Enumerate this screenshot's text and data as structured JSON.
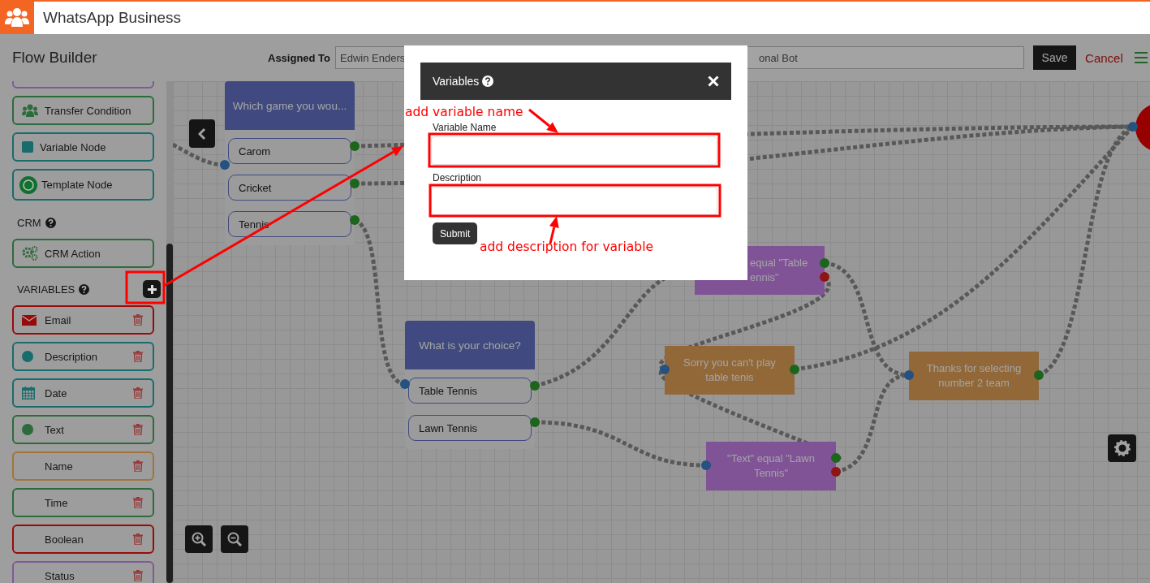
{
  "app": {
    "title": "WhatsApp Business"
  },
  "toolbar": {
    "title": "Flow Builder",
    "assigned_label": "Assigned To",
    "assigned_value": "Edwin Enders",
    "bot_name_value": "onal Bot",
    "save": "Save",
    "cancel": "Cancel"
  },
  "sidebar": {
    "nodes": [
      {
        "color": "#7d5a98",
        "kind": "plain"
      },
      {
        "label": "Transfer Condition",
        "color": "#2c6b3c",
        "kind": "people"
      },
      {
        "label": "Variable Node",
        "color": "#186c6c",
        "kind": "square"
      },
      {
        "label": "Template Node",
        "color": "#186c6c",
        "kind": "badge"
      }
    ],
    "crm_heading": "CRM",
    "crm_items": [
      {
        "label": "CRM Action",
        "color": "#2c6b3c",
        "kind": "gears"
      }
    ],
    "variables_heading": "VARIABLES",
    "variables": [
      {
        "label": "Email",
        "color": "#990b0b",
        "kind": "envelope"
      },
      {
        "label": "Description",
        "color": "#186c6c",
        "kind": "dot"
      },
      {
        "label": "Date",
        "color": "#186c6c",
        "kind": "calendar"
      },
      {
        "label": "Text",
        "color": "#2c6b3c",
        "kind": "dot"
      },
      {
        "label": "Name",
        "color": "#a3743a",
        "kind": "plain"
      },
      {
        "label": "Time",
        "color": "#2c6b3c",
        "kind": "plain"
      },
      {
        "label": "Boolean",
        "color": "#990b0b",
        "kind": "plain"
      },
      {
        "label": "Status",
        "color": "#7d5a98",
        "kind": "plain"
      }
    ]
  },
  "canvas": {
    "question_nodes": [
      {
        "title": "Which game you wou...",
        "options": [
          "Carom",
          "Cricket",
          "Tennis"
        ]
      },
      {
        "title": "What is your choice?",
        "options": [
          "Table Tennis",
          "Lawn Tennis"
        ]
      }
    ],
    "message_nodes": [
      {
        "kind": "condition",
        "lines": [
          "equal \"Table",
          "ennis\""
        ]
      },
      {
        "kind": "message",
        "lines": [
          "Sorry you can't play",
          "table tenis"
        ]
      },
      {
        "kind": "message",
        "lines": [
          "Thanks for selecting",
          "number 2 team"
        ]
      },
      {
        "kind": "condition",
        "lines": [
          "\"Text\" equal \"Lawn",
          "Tennis\""
        ]
      }
    ]
  },
  "modal": {
    "title": "Variables",
    "fields": [
      {
        "label": "Variable Name"
      },
      {
        "label": "Description"
      }
    ],
    "submit": "Submit"
  },
  "annotations": [
    "add variable name",
    "add description for variable"
  ]
}
